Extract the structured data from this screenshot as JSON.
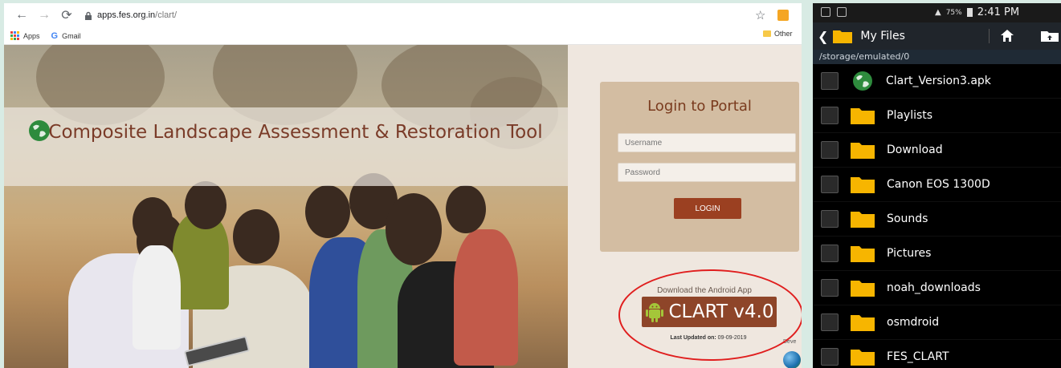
{
  "browser": {
    "url_host": "apps.fes.org.in",
    "url_path": "/clart/",
    "bookmarks": [
      "Apps",
      "Gmail"
    ],
    "other_bookmarks": "Other",
    "site_title": "Composite Landscape Assessment & Restoration Tool",
    "login": {
      "title": "Login to Portal",
      "username_placeholder": "Username",
      "password_placeholder": "Password",
      "button": "LOGIN"
    },
    "android": {
      "label": "Download the Android App",
      "button": "CLART v4.0",
      "updated_label": "Last Updated on:",
      "updated_date": "09-09-2019",
      "dev_label": "Deve"
    }
  },
  "phone": {
    "status": {
      "battery": "75%",
      "time": "2:41 PM"
    },
    "title": "My Files",
    "path": "/storage/emulated/0",
    "files": [
      {
        "name": "Clart_Version3.apk",
        "type": "apk"
      },
      {
        "name": "Playlists",
        "type": "folder"
      },
      {
        "name": "Download",
        "type": "folder"
      },
      {
        "name": "Canon EOS 1300D",
        "type": "folder"
      },
      {
        "name": "Sounds",
        "type": "folder"
      },
      {
        "name": "Pictures",
        "type": "folder"
      },
      {
        "name": "noah_downloads",
        "type": "folder"
      },
      {
        "name": "osmdroid",
        "type": "folder"
      },
      {
        "name": "FES_CLART",
        "type": "folder"
      }
    ]
  },
  "colors": {
    "accent_brown": "#8e4529",
    "login_card": "#d3bda2",
    "highlight_red": "#e01e1e",
    "folder_yellow": "#f7b500"
  }
}
